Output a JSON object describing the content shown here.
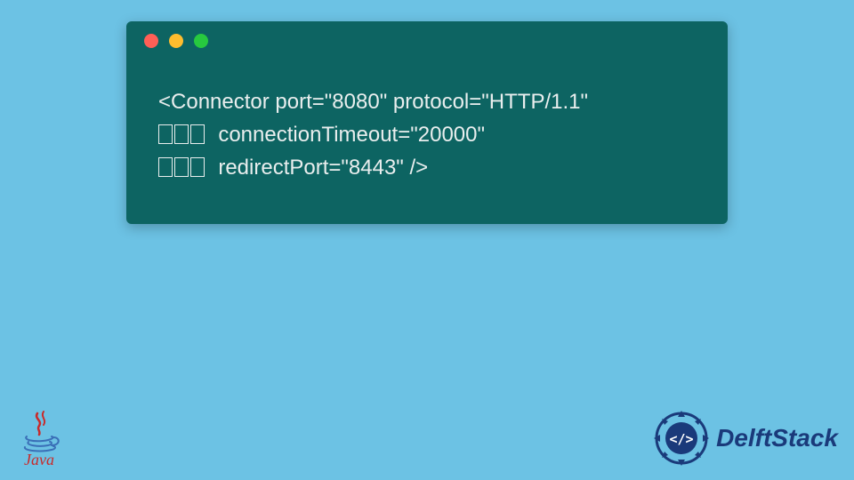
{
  "code": {
    "line1": "<Connector port=\"8080\" protocol=\"HTTP/1.1\"",
    "line2_text": "  connectionTimeout=\"20000\"",
    "line3_text": "  redirectPort=\"8443\" />"
  },
  "java_logo_text": "Java",
  "brand_text": "DelftStack",
  "colors": {
    "background": "#6cc2e4",
    "window": "#0d6462",
    "code_text": "#e9eeee",
    "brand_blue": "#1a3a7a",
    "java_red": "#c92a2a"
  }
}
